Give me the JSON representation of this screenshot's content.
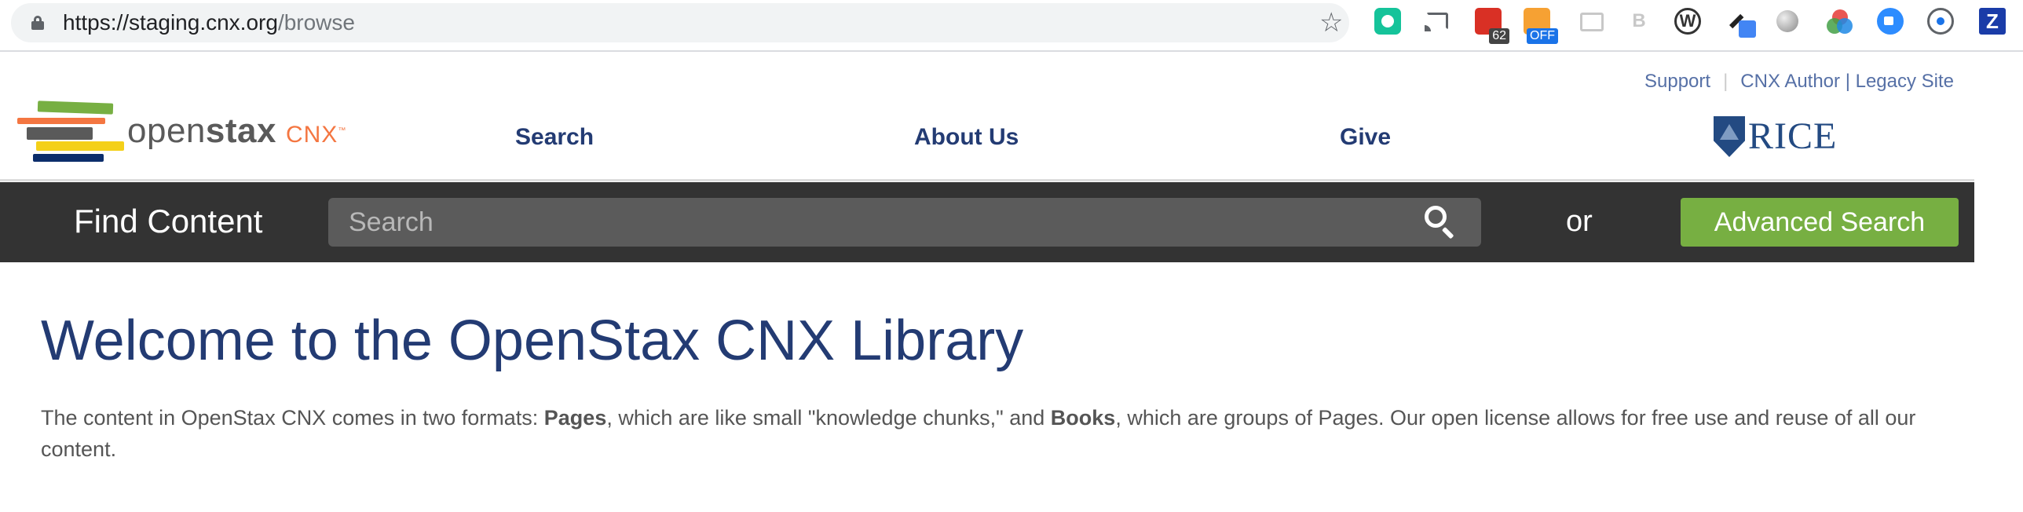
{
  "browser": {
    "url_host": "https://staging.cnx.org",
    "url_path": "/browse",
    "extensions": {
      "calendar_badge": "62",
      "off_badge": "OFF",
      "b_label": "B",
      "w_label": "W",
      "z_label": "Z"
    }
  },
  "header": {
    "utility_links": {
      "support": "Support",
      "cnx_author": "CNX Author",
      "separator": "|",
      "legacy_site": "Legacy Site"
    },
    "logo": {
      "open": "open",
      "stax": "stax",
      "cnx": "CNX",
      "tm": "™"
    },
    "nav": {
      "search": "Search",
      "about": "About Us",
      "give": "Give"
    },
    "rice_logo": "RICE"
  },
  "find_bar": {
    "title": "Find Content",
    "search_placeholder": "Search",
    "or": "or",
    "advanced_search": "Advanced Search"
  },
  "main": {
    "heading": "Welcome to the OpenStax CNX Library",
    "intro": {
      "part1": "The content in OpenStax CNX comes in two formats: ",
      "pages": "Pages",
      "part2": ", which are like small \"knowledge chunks,\" and ",
      "books": "Books",
      "part3": ", which are groups of Pages. Our open license allows for free use and reuse of all our content."
    }
  },
  "colors": {
    "nav_blue": "#233b73",
    "link_blue": "#5670a6",
    "find_bar_bg": "#333333",
    "advanced_green": "#77af42",
    "cnx_orange": "#f47641"
  }
}
